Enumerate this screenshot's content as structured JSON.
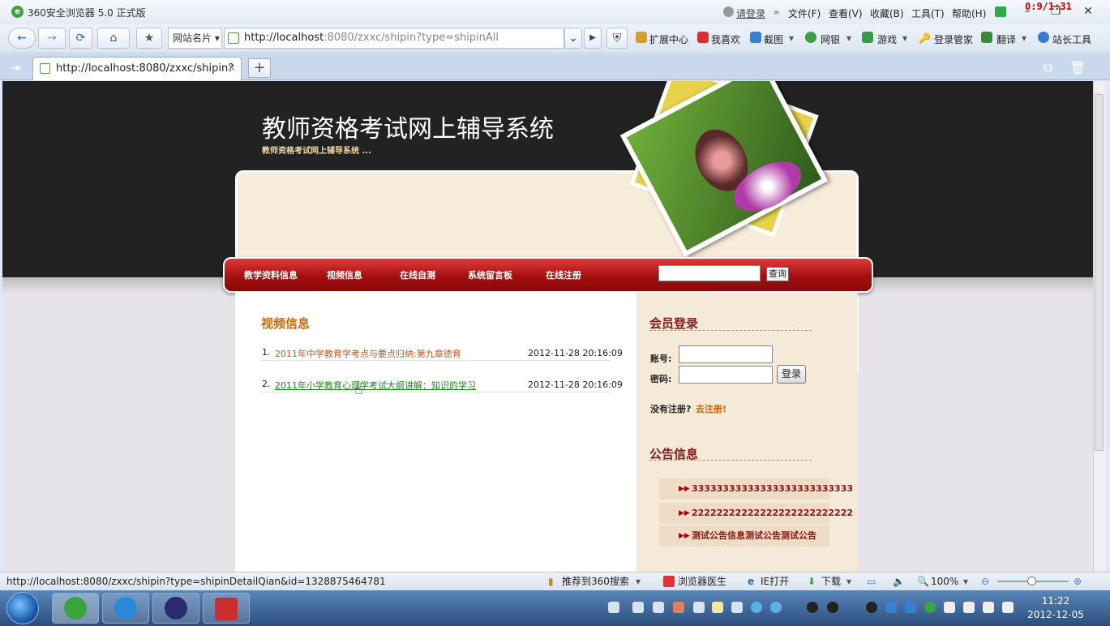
{
  "window": {
    "title": "360安全浏览器 5.0 正式版",
    "login": "请登录",
    "menus": [
      "文件(F)",
      "查看(V)",
      "收藏(B)",
      "工具(T)",
      "帮助(H)"
    ],
    "timer": "0:9/1:31"
  },
  "toolbar": {
    "fav_select": "网站名片",
    "url_host": "http://localhost",
    "url_rest": ":8080/zxxc/shipin?type=shipinAll",
    "links": [
      "扩展中心",
      "我喜欢",
      "截图",
      "网银",
      "游戏",
      "登录管家",
      "翻译",
      "站长工具"
    ]
  },
  "tab": {
    "label": "http://localhost:8080/zxxc/shipin?t..."
  },
  "site": {
    "title": "教师资格考试网上辅导系统",
    "subtitle": "教师资格考试网上辅导系统 ..."
  },
  "nav": {
    "items": [
      "教学资料信息",
      "视频信息",
      "在线自测",
      "系统留言板",
      "在线注册"
    ],
    "search_btn": "查询"
  },
  "main": {
    "title": "视频信息",
    "rows": [
      {
        "num": "1.",
        "title": "2011年中学教育学考点与要点归纳:第九章德育",
        "date": "2012-11-28 20:16:09"
      },
      {
        "num": "2.",
        "title": "2011年小学教育心理学考试大纲讲解：知识的学习",
        "date": "2012-11-28 20:16:09"
      }
    ]
  },
  "sidebar": {
    "login_title": "会员登录",
    "account_label": "账号:",
    "password_label": "密码:",
    "login_btn": "登录",
    "no_reg": "没有注册?",
    "reg_link": "去注册!",
    "notice_title": "公告信息",
    "notices": [
      "33333333333333333333333333",
      "22222222222222222222222222",
      "测试公告信息测试公告测试公告"
    ]
  },
  "status": {
    "url": "http://localhost:8080/zxxc/shipin?type=shipinDetailQian&id=1328875464781",
    "recommend": "推荐到360搜索",
    "doctor": "浏览器医生",
    "ie": "IE打开",
    "download": "下载",
    "zoom": "100%"
  },
  "clock": {
    "time": "11:22",
    "date": "2012-12-05"
  },
  "colors": {
    "nav_red": "#b71c1c",
    "link_orange": "#c1591b",
    "link_green": "#1a8a1a"
  }
}
